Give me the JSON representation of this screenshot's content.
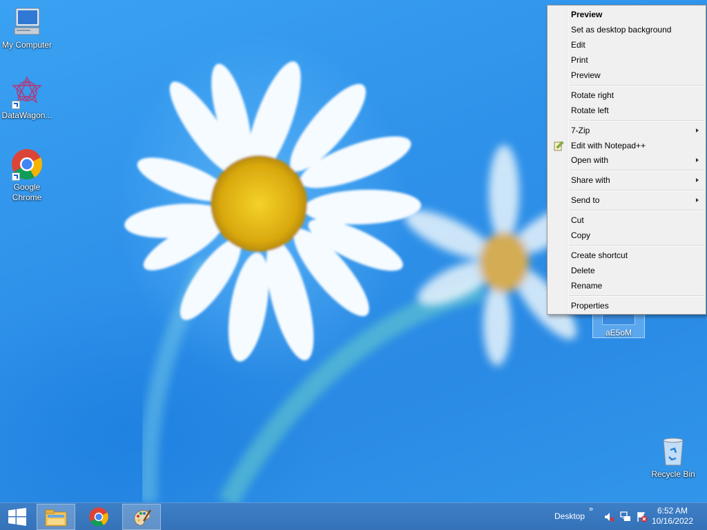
{
  "desktop": {
    "icons": [
      {
        "name": "my-computer-icon",
        "label": "My Computer"
      },
      {
        "name": "datawagon-icon",
        "label": "DataWagon..."
      },
      {
        "name": "chrome-icon",
        "label": "Google Chrome"
      },
      {
        "name": "recycle-bin-icon",
        "label": "Recycle Bin"
      }
    ],
    "selected_file_label": "aE5oM"
  },
  "context_menu": {
    "items": [
      {
        "label": "Preview",
        "bold": true
      },
      {
        "label": "Set as desktop background"
      },
      {
        "label": "Edit"
      },
      {
        "label": "Print"
      },
      {
        "label": "Preview"
      },
      {
        "label": "Rotate right"
      },
      {
        "label": "Rotate left"
      },
      {
        "label": "7-Zip",
        "submenu": true
      },
      {
        "label": "Edit with Notepad++",
        "icon": "notepad-plus-plus-icon"
      },
      {
        "label": "Open with",
        "submenu": true
      },
      {
        "label": "Share with",
        "submenu": true
      },
      {
        "label": "Send to",
        "submenu": true
      },
      {
        "label": "Cut"
      },
      {
        "label": "Copy"
      },
      {
        "label": "Create shortcut"
      },
      {
        "label": "Delete"
      },
      {
        "label": "Rename"
      },
      {
        "label": "Properties"
      }
    ]
  },
  "taskbar": {
    "start_icon": "windows-logo-icon",
    "pinned": [
      "file-explorer-icon",
      "chrome-icon",
      "paint-icon"
    ],
    "desktop_toolbar_label": "Desktop",
    "chevron": "»",
    "clock": {
      "time": "6:52 AM",
      "date": "10/16/2022"
    }
  },
  "colors": {
    "taskbar": "#3572b8",
    "menu_bg": "#f0f0f0",
    "desktop_blue": "#2f92ea"
  }
}
